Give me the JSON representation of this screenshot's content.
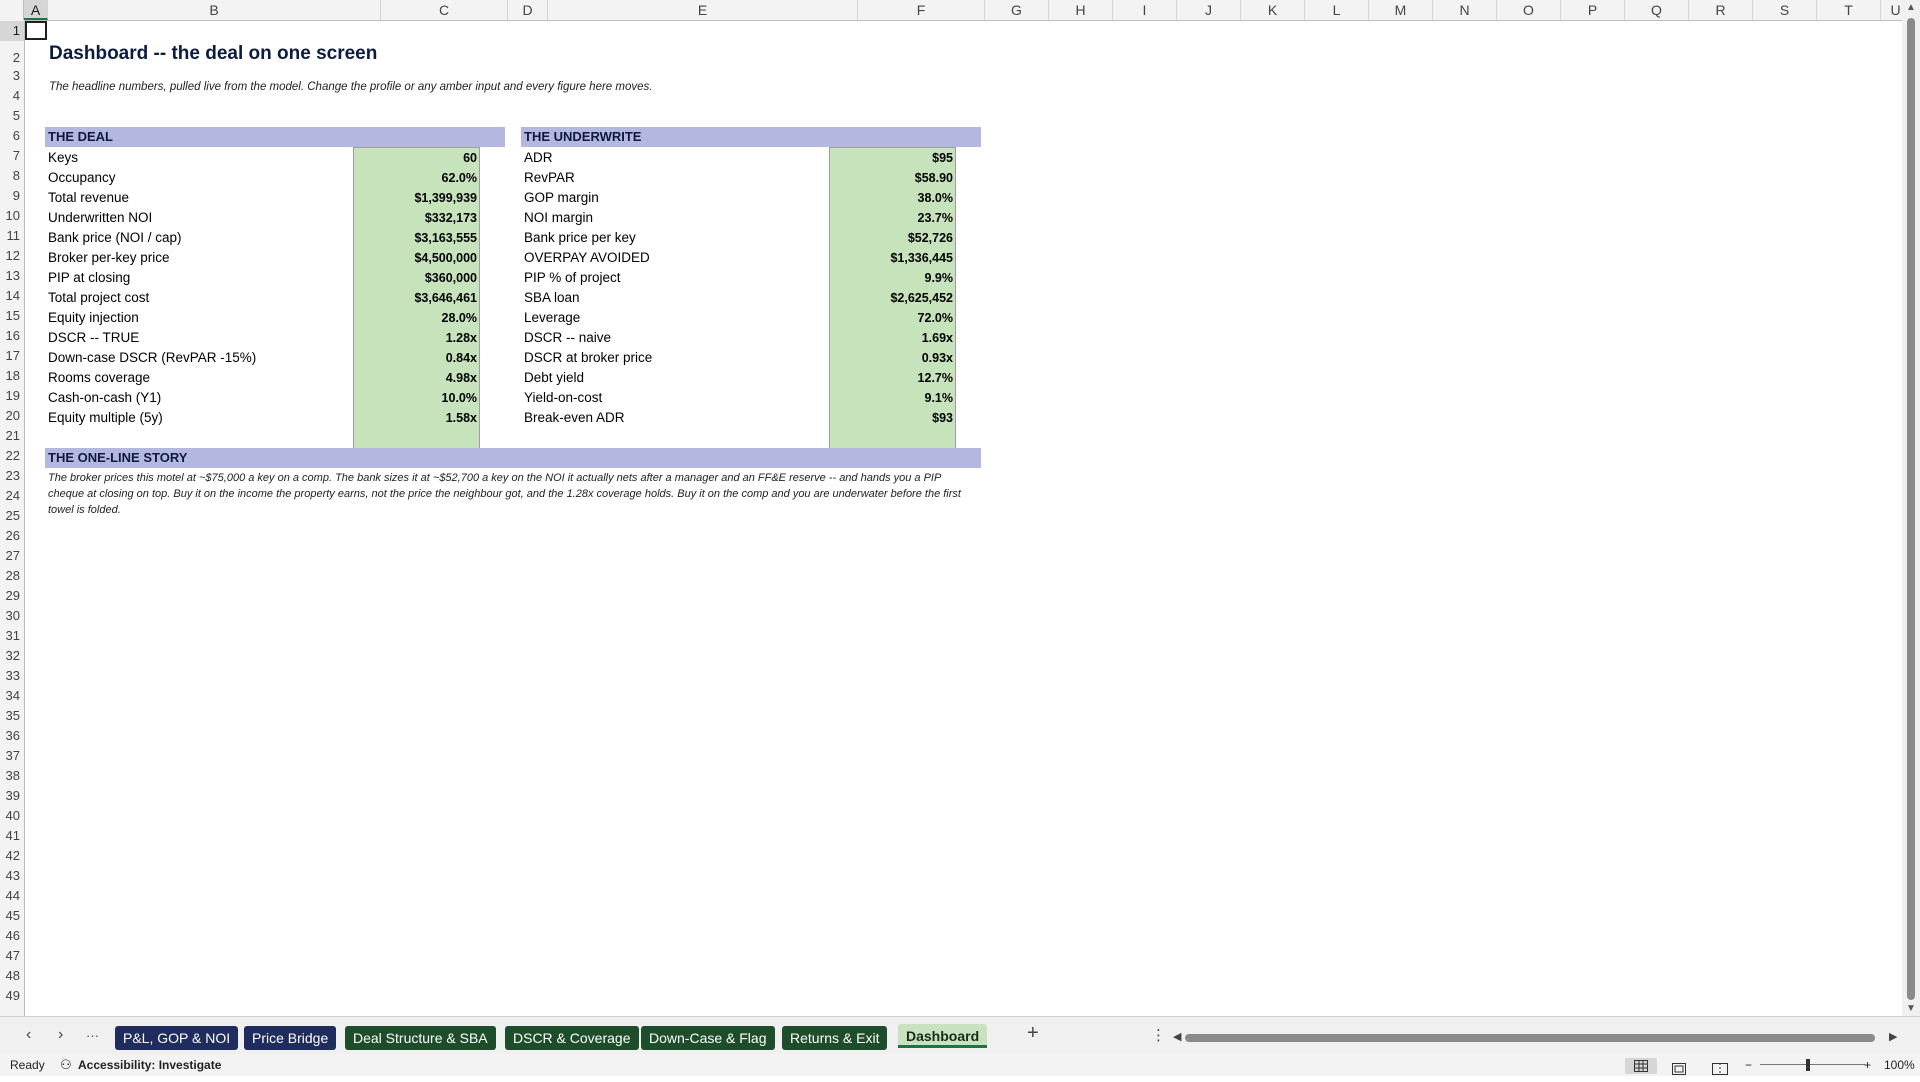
{
  "columns": [
    "A",
    "B",
    "C",
    "D",
    "E",
    "F",
    "G",
    "H",
    "I",
    "J",
    "K",
    "L",
    "M",
    "N",
    "O",
    "P",
    "Q",
    "R",
    "S",
    "T",
    "U"
  ],
  "rows": [
    "1",
    "2",
    "3",
    "4",
    "5",
    "6",
    "7",
    "8",
    "9",
    "10",
    "11",
    "12",
    "13",
    "14",
    "15",
    "16",
    "17",
    "18",
    "19",
    "20",
    "21",
    "22",
    "23",
    "24",
    "25",
    "26",
    "27",
    "28",
    "29",
    "30",
    "31",
    "32",
    "33",
    "34",
    "35",
    "36",
    "37",
    "38",
    "39",
    "40",
    "41",
    "42",
    "43",
    "44",
    "45",
    "46",
    "47",
    "48",
    "49"
  ],
  "sheet": {
    "title": "Dashboard -- the deal on one screen",
    "subtitle": "The headline numbers, pulled live from the model. Change the profile or any amber input and every figure here moves.",
    "deal": {
      "header": "THE DEAL",
      "items": [
        {
          "label": "Keys",
          "value": "60"
        },
        {
          "label": "Occupancy",
          "value": "62.0%"
        },
        {
          "label": "Total revenue",
          "value": "$1,399,939"
        },
        {
          "label": "Underwritten NOI",
          "value": "$332,173"
        },
        {
          "label": "Bank price (NOI / cap)",
          "value": "$3,163,555"
        },
        {
          "label": "Broker per-key price",
          "value": "$4,500,000"
        },
        {
          "label": "PIP at closing",
          "value": "$360,000"
        },
        {
          "label": "Total project cost",
          "value": "$3,646,461"
        },
        {
          "label": "Equity injection",
          "value": "28.0%"
        },
        {
          "label": "DSCR -- TRUE",
          "value": "1.28x"
        },
        {
          "label": "Down-case DSCR (RevPAR -15%)",
          "value": "0.84x"
        },
        {
          "label": "Rooms coverage",
          "value": "4.98x"
        },
        {
          "label": "Cash-on-cash (Y1)",
          "value": "10.0%"
        },
        {
          "label": "Equity multiple (5y)",
          "value": "1.58x"
        }
      ]
    },
    "underwrite": {
      "header": "THE UNDERWRITE",
      "items": [
        {
          "label": "ADR",
          "value": "$95"
        },
        {
          "label": "RevPAR",
          "value": "$58.90"
        },
        {
          "label": "GOP margin",
          "value": "38.0%"
        },
        {
          "label": "NOI margin",
          "value": "23.7%"
        },
        {
          "label": "Bank price per key",
          "value": "$52,726"
        },
        {
          "label": "OVERPAY AVOIDED",
          "value": "$1,336,445"
        },
        {
          "label": "PIP % of project",
          "value": "9.9%"
        },
        {
          "label": "SBA loan",
          "value": "$2,625,452"
        },
        {
          "label": "Leverage",
          "value": "72.0%"
        },
        {
          "label": "DSCR -- naive",
          "value": "1.69x"
        },
        {
          "label": "DSCR at broker price",
          "value": "0.93x"
        },
        {
          "label": "Debt yield",
          "value": "12.7%"
        },
        {
          "label": "Yield-on-cost",
          "value": "9.1%"
        },
        {
          "label": "Break-even ADR",
          "value": "$93"
        }
      ]
    },
    "story": {
      "header": "THE ONE-LINE STORY",
      "text": "The broker prices this motel at ~$75,000 a key on a comp. The bank sizes it at ~$52,700 a key on the NOI it actually nets after a manager and an FF&E reserve -- and hands you a PIP cheque at closing on top. Buy it on the income the property earns, not the price the neighbour got, and the 1.28x coverage holds. Buy it on the comp and you are underwater before the first towel is folded."
    }
  },
  "tabs": [
    {
      "label": "P&L, GOP & NOI",
      "style": "navy"
    },
    {
      "label": "Price Bridge",
      "style": "navy"
    },
    {
      "label": "Deal Structure & SBA",
      "style": "green"
    },
    {
      "label": "DSCR & Coverage",
      "style": "green"
    },
    {
      "label": "Down-Case & Flag",
      "style": "green"
    },
    {
      "label": "Returns & Exit",
      "style": "green"
    },
    {
      "label": "Dashboard",
      "style": "active"
    }
  ],
  "tabnav": {
    "prev": "‹",
    "next": "›",
    "more": "···",
    "add": "+",
    "options": "⋮"
  },
  "status": {
    "ready": "Ready",
    "accessibility": "Accessibility: Investigate",
    "zoom": "100%",
    "zoom_minus": "−",
    "zoom_plus": "+"
  }
}
